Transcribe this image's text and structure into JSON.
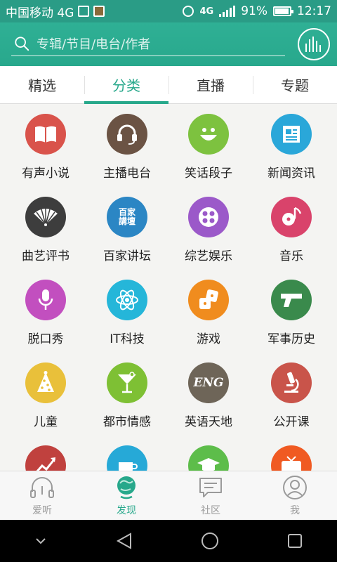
{
  "status_bar": {
    "carrier": "中国移动 4G",
    "network_badge": "4G",
    "battery": "91%",
    "time": "12:17"
  },
  "search": {
    "placeholder": "专辑/节目/电台/作者"
  },
  "tabs": [
    {
      "label": "精选",
      "active": false
    },
    {
      "label": "分类",
      "active": true
    },
    {
      "label": "直播",
      "active": false
    },
    {
      "label": "专题",
      "active": false
    }
  ],
  "categories": [
    {
      "label": "有声小说",
      "color": "#d9534b",
      "icon": "book-icon"
    },
    {
      "label": "主播电台",
      "color": "#6b5344",
      "icon": "headset-icon"
    },
    {
      "label": "笑话段子",
      "color": "#7dc23f",
      "icon": "smile-icon"
    },
    {
      "label": "新闻资讯",
      "color": "#2aa7d9",
      "icon": "newspaper-icon"
    },
    {
      "label": "曲艺评书",
      "color": "#3d3d3d",
      "icon": "fan-icon"
    },
    {
      "label": "百家讲坛",
      "color": "#2b86c4",
      "icon": "lecture-icon",
      "icon_text": "百家\n講壇"
    },
    {
      "label": "综艺娱乐",
      "color": "#9b59c9",
      "icon": "film-reel-icon"
    },
    {
      "label": "音乐",
      "color": "#d9436b",
      "icon": "music-icon"
    },
    {
      "label": "脱口秀",
      "color": "#c24fbf",
      "icon": "microphone-icon"
    },
    {
      "label": "IT科技",
      "color": "#25b6d9",
      "icon": "atom-icon"
    },
    {
      "label": "游戏",
      "color": "#f08c1e",
      "icon": "dice-icon"
    },
    {
      "label": "军事历史",
      "color": "#3a8a4c",
      "icon": "pistol-icon"
    },
    {
      "label": "儿童",
      "color": "#e9c03a",
      "icon": "party-hat-icon"
    },
    {
      "label": "都市情感",
      "color": "#7ec034",
      "icon": "cocktail-icon"
    },
    {
      "label": "英语天地",
      "color": "#6e6558",
      "icon": "eng-icon",
      "icon_text": "ENG"
    },
    {
      "label": "公开课",
      "color": "#c9544a",
      "icon": "microscope-icon"
    },
    {
      "label": "",
      "color": "#c0413e",
      "icon": "chart-icon"
    },
    {
      "label": "",
      "color": "#26a9d7",
      "icon": "coffee-icon"
    },
    {
      "label": "",
      "color": "#5dbd4a",
      "icon": "graduation-cap-icon"
    },
    {
      "label": "",
      "color": "#f05a22",
      "icon": "tv-icon"
    }
  ],
  "bottom_nav": [
    {
      "label": "爱听",
      "icon": "headphones-icon",
      "active": false
    },
    {
      "label": "发现",
      "icon": "globe-icon",
      "active": true
    },
    {
      "label": "社区",
      "icon": "chat-icon",
      "active": false
    },
    {
      "label": "我",
      "icon": "user-icon",
      "active": false
    }
  ],
  "colors": {
    "brand": "#27a88b",
    "header": "#2fb095",
    "background": "#f4f4f2"
  }
}
